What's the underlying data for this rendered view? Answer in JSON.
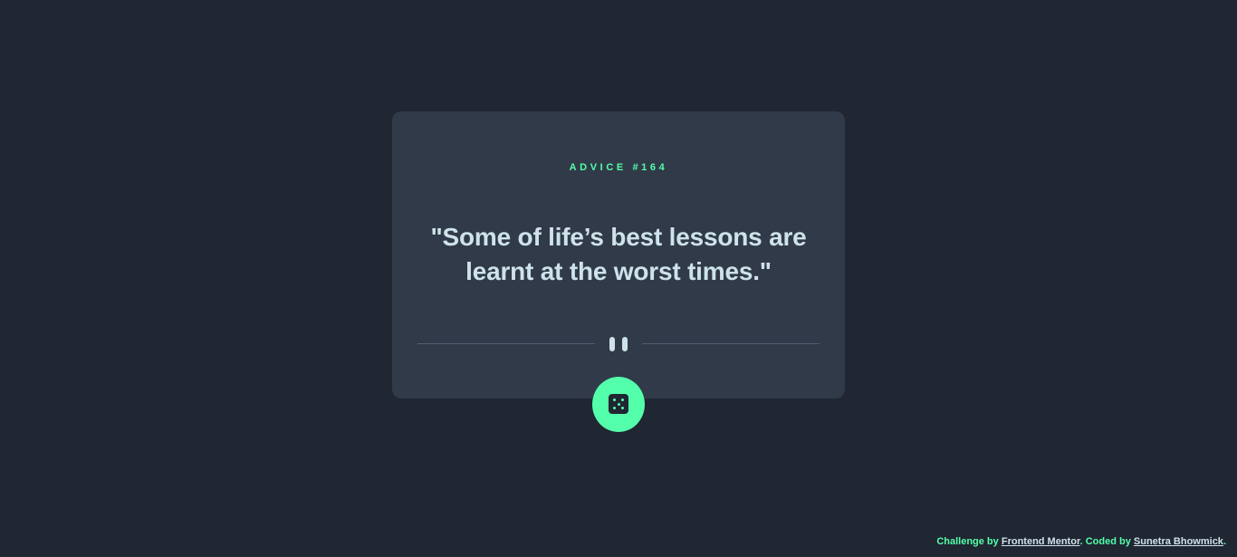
{
  "card": {
    "advice_id": "ADVICE #164",
    "advice_text": "\"Some of life’s best lessons are learnt at the worst times.\""
  },
  "divider": {
    "icon": "pause-icon"
  },
  "dice_button": {
    "icon": "dice-icon"
  },
  "footer": {
    "prefix": "Challenge by ",
    "link_one": "Frontend Mentor",
    "middle": ". Coded by ",
    "link_two": "Sunetra Bhowmick",
    "suffix": "."
  },
  "colors": {
    "background": "#202632",
    "card": "#313a48",
    "accent": "#53ffaa",
    "text": "#cee3e9",
    "divider": "#4f5d74"
  }
}
